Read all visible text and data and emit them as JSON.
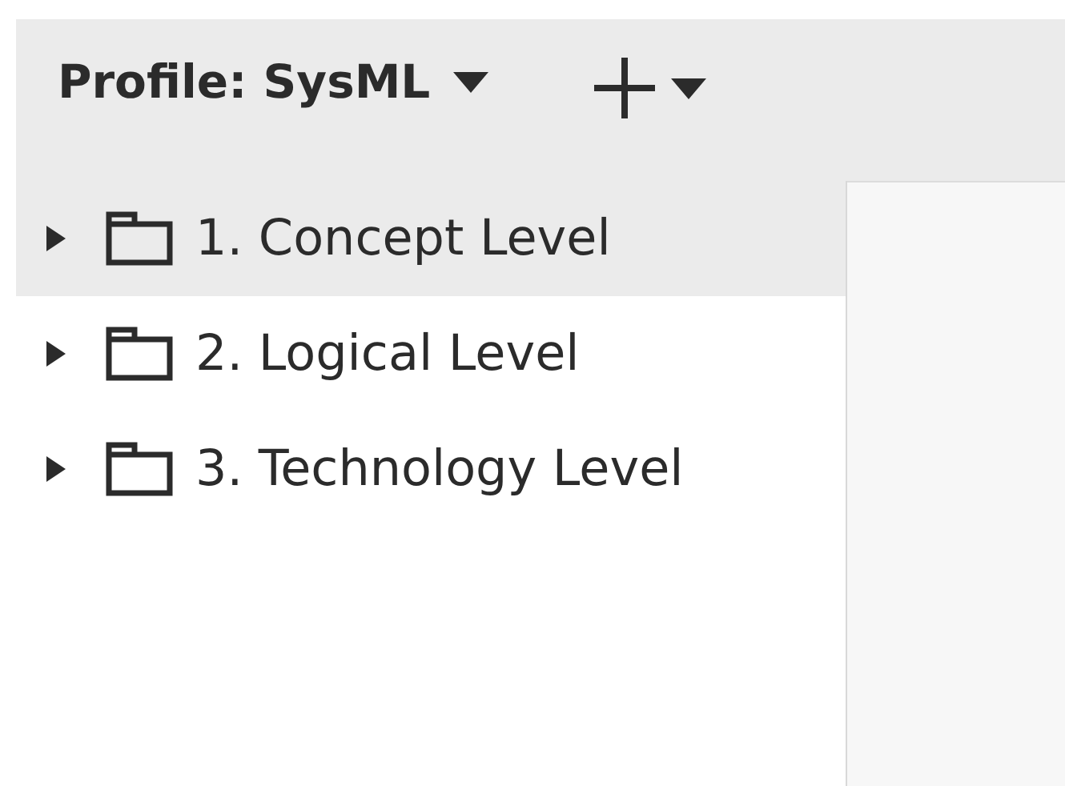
{
  "toolbar": {
    "profile_menu": {
      "label": "Profile: SysML"
    }
  },
  "tree": [
    {
      "label": "1. Concept Level",
      "selected": true,
      "expanded": false
    },
    {
      "label": "2. Logical Level",
      "selected": false,
      "expanded": false
    },
    {
      "label": "3. Technology Level",
      "selected": false,
      "expanded": false
    }
  ]
}
